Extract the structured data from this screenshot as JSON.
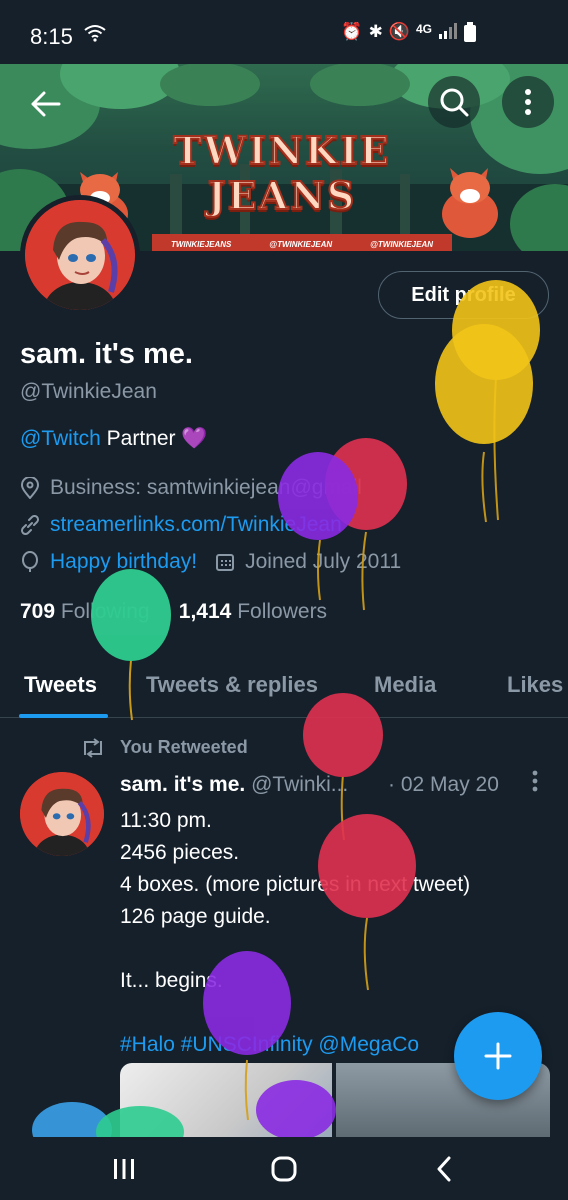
{
  "status_bar": {
    "time": "8:15",
    "network": "4G",
    "icons": [
      "wifi-icon",
      "alarm-icon",
      "bluetooth-icon",
      "mute-icon",
      "signal-icon",
      "battery-icon"
    ]
  },
  "banner": {
    "title": "TWINKIE JEANS",
    "socials": [
      "TWINKIEJEANS",
      "@TWINKIEJEAN",
      "@TWINKIEJEAN"
    ]
  },
  "profile": {
    "name": "sam. it's me.",
    "handle": "@TwinkieJean",
    "edit_label": "Edit profile",
    "bio_link": "@Twitch",
    "bio_text": " Partner ",
    "bio_emoji": "💜",
    "business": "Business: samtwinkiejean@gmail",
    "website": "streamerlinks.com/TwinkieJean",
    "birthday": "Happy birthday!",
    "joined": "Joined July 2011",
    "following_count": "709",
    "following_label": "Following",
    "followers_count": "1,414",
    "followers_label": "Followers"
  },
  "tabs": [
    {
      "label": "Tweets",
      "active": true
    },
    {
      "label": "Tweets & replies",
      "active": false
    },
    {
      "label": "Media",
      "active": false
    },
    {
      "label": "Likes",
      "active": false
    }
  ],
  "tweet": {
    "retweet_label": "You Retweeted",
    "author": "sam. it's me.",
    "handle": "@Twinki...",
    "date": "· 02 May 20",
    "lines": [
      "11:30 pm.",
      "2456 pieces.",
      "4 boxes. (more pictures in next tweet)",
      "126 page guide.",
      "",
      "It... begins.",
      ""
    ],
    "hashtags": "#Halo #UNSCInfinity @MegaCo"
  },
  "colors": {
    "background": "#15202b",
    "accent": "#1d9bf0",
    "muted": "#8b98a5"
  }
}
